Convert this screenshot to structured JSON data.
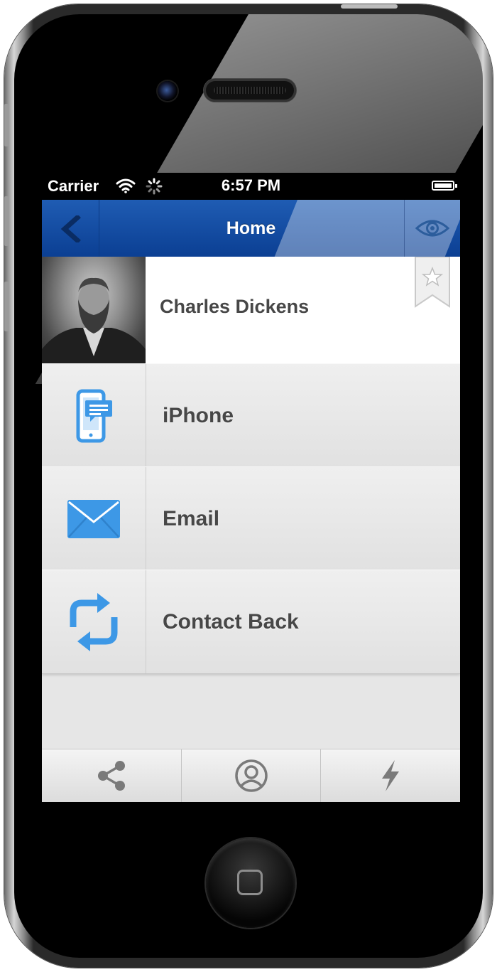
{
  "status_bar": {
    "carrier": "Carrier",
    "time": "6:57 PM"
  },
  "nav_bar": {
    "title": "Home",
    "back_icon": "chevron-left-icon",
    "right_icon": "eye-icon"
  },
  "profile": {
    "name": "Charles Dickens",
    "bookmark_icon": "star-bookmark-icon"
  },
  "rows": [
    {
      "label": "iPhone",
      "icon": "phone-message-icon"
    },
    {
      "label": "Email",
      "icon": "envelope-icon"
    },
    {
      "label": "Contact Back",
      "icon": "refresh-arrows-icon"
    }
  ],
  "tab_bar": {
    "items": [
      {
        "icon": "share-icon"
      },
      {
        "icon": "profile-icon"
      },
      {
        "icon": "lightning-icon"
      }
    ]
  },
  "colors": {
    "nav_blue": "#1f5cb3",
    "icon_blue": "#3d98e6",
    "label_gray": "#474747"
  }
}
